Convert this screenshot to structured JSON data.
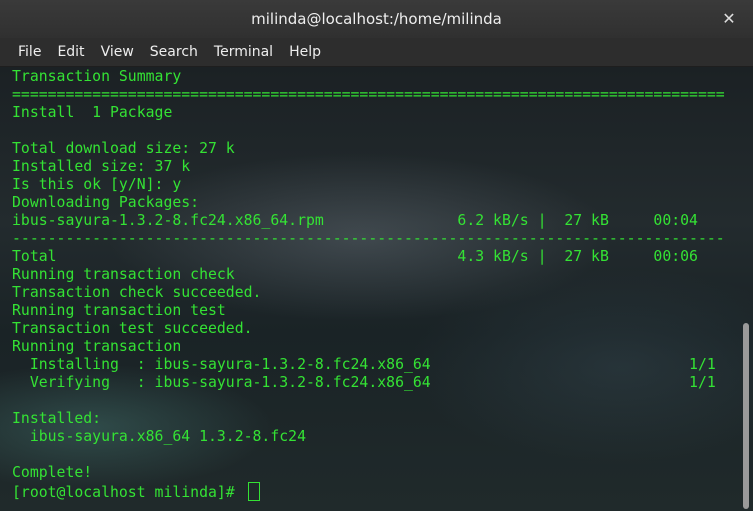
{
  "window": {
    "title": "milinda@localhost:/home/milinda",
    "close_glyph": "✕"
  },
  "menubar": {
    "items": [
      {
        "label": "File"
      },
      {
        "label": "Edit"
      },
      {
        "label": "View"
      },
      {
        "label": "Search"
      },
      {
        "label": "Terminal"
      },
      {
        "label": "Help"
      }
    ]
  },
  "terminal": {
    "text_color": "#34e234",
    "lines": [
      "Transaction Summary",
      "================================================================================",
      "Install  1 Package",
      "",
      "Total download size: 27 k",
      "Installed size: 37 k",
      "Is this ok [y/N]: y",
      "Downloading Packages:",
      "ibus-sayura-1.3.2-8.fc24.x86_64.rpm               6.2 kB/s |  27 kB     00:04",
      "--------------------------------------------------------------------------------",
      "Total                                             4.3 kB/s |  27 kB     00:06",
      "Running transaction check",
      "Transaction check succeeded.",
      "Running transaction test",
      "Transaction test succeeded.",
      "Running transaction",
      "  Installing  : ibus-sayura-1.3.2-8.fc24.x86_64                             1/1",
      "  Verifying   : ibus-sayura-1.3.2-8.fc24.x86_64                             1/1",
      "",
      "Installed:",
      "  ibus-sayura.x86_64 1.3.2-8.fc24",
      "",
      "Complete!"
    ],
    "prompt": "[root@localhost milinda]# "
  }
}
